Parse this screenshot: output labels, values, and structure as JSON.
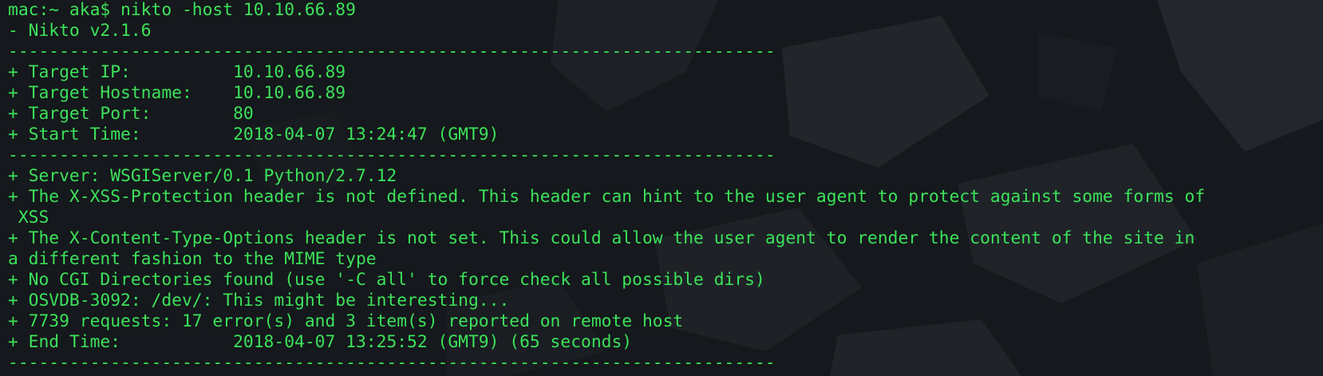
{
  "terminal": {
    "prompt": "mac:~ aka$ nikto -host 10.10.66.89",
    "version": "- Nikto v2.1.6",
    "separator": "---------------------------------------------------------------------------",
    "target_ip": "+ Target IP:          10.10.66.89",
    "target_hostname": "+ Target Hostname:    10.10.66.89",
    "target_port": "+ Target Port:        80",
    "start_time": "+ Start Time:         2018-04-07 13:24:47 (GMT9)",
    "server": "+ Server: WSGIServer/0.1 Python/2.7.12",
    "xss_line1": "+ The X-XSS-Protection header is not defined. This header can hint to the user agent to protect against some forms of",
    "xss_line2": " XSS",
    "cto_line1": "+ The X-Content-Type-Options header is not set. This could allow the user agent to render the content of the site in",
    "cto_line2": "a different fashion to the MIME type",
    "cgi": "+ No CGI Directories found (use '-C all' to force check all possible dirs)",
    "osvdb": "+ OSVDB-3092: /dev/: This might be interesting...",
    "requests": "+ 7739 requests: 17 error(s) and 3 item(s) reported on remote host",
    "end_time": "+ End Time:           2018-04-07 13:25:52 (GMT9) (65 seconds)"
  },
  "colors": {
    "text": "#3ce25a",
    "background": "#15181c"
  }
}
